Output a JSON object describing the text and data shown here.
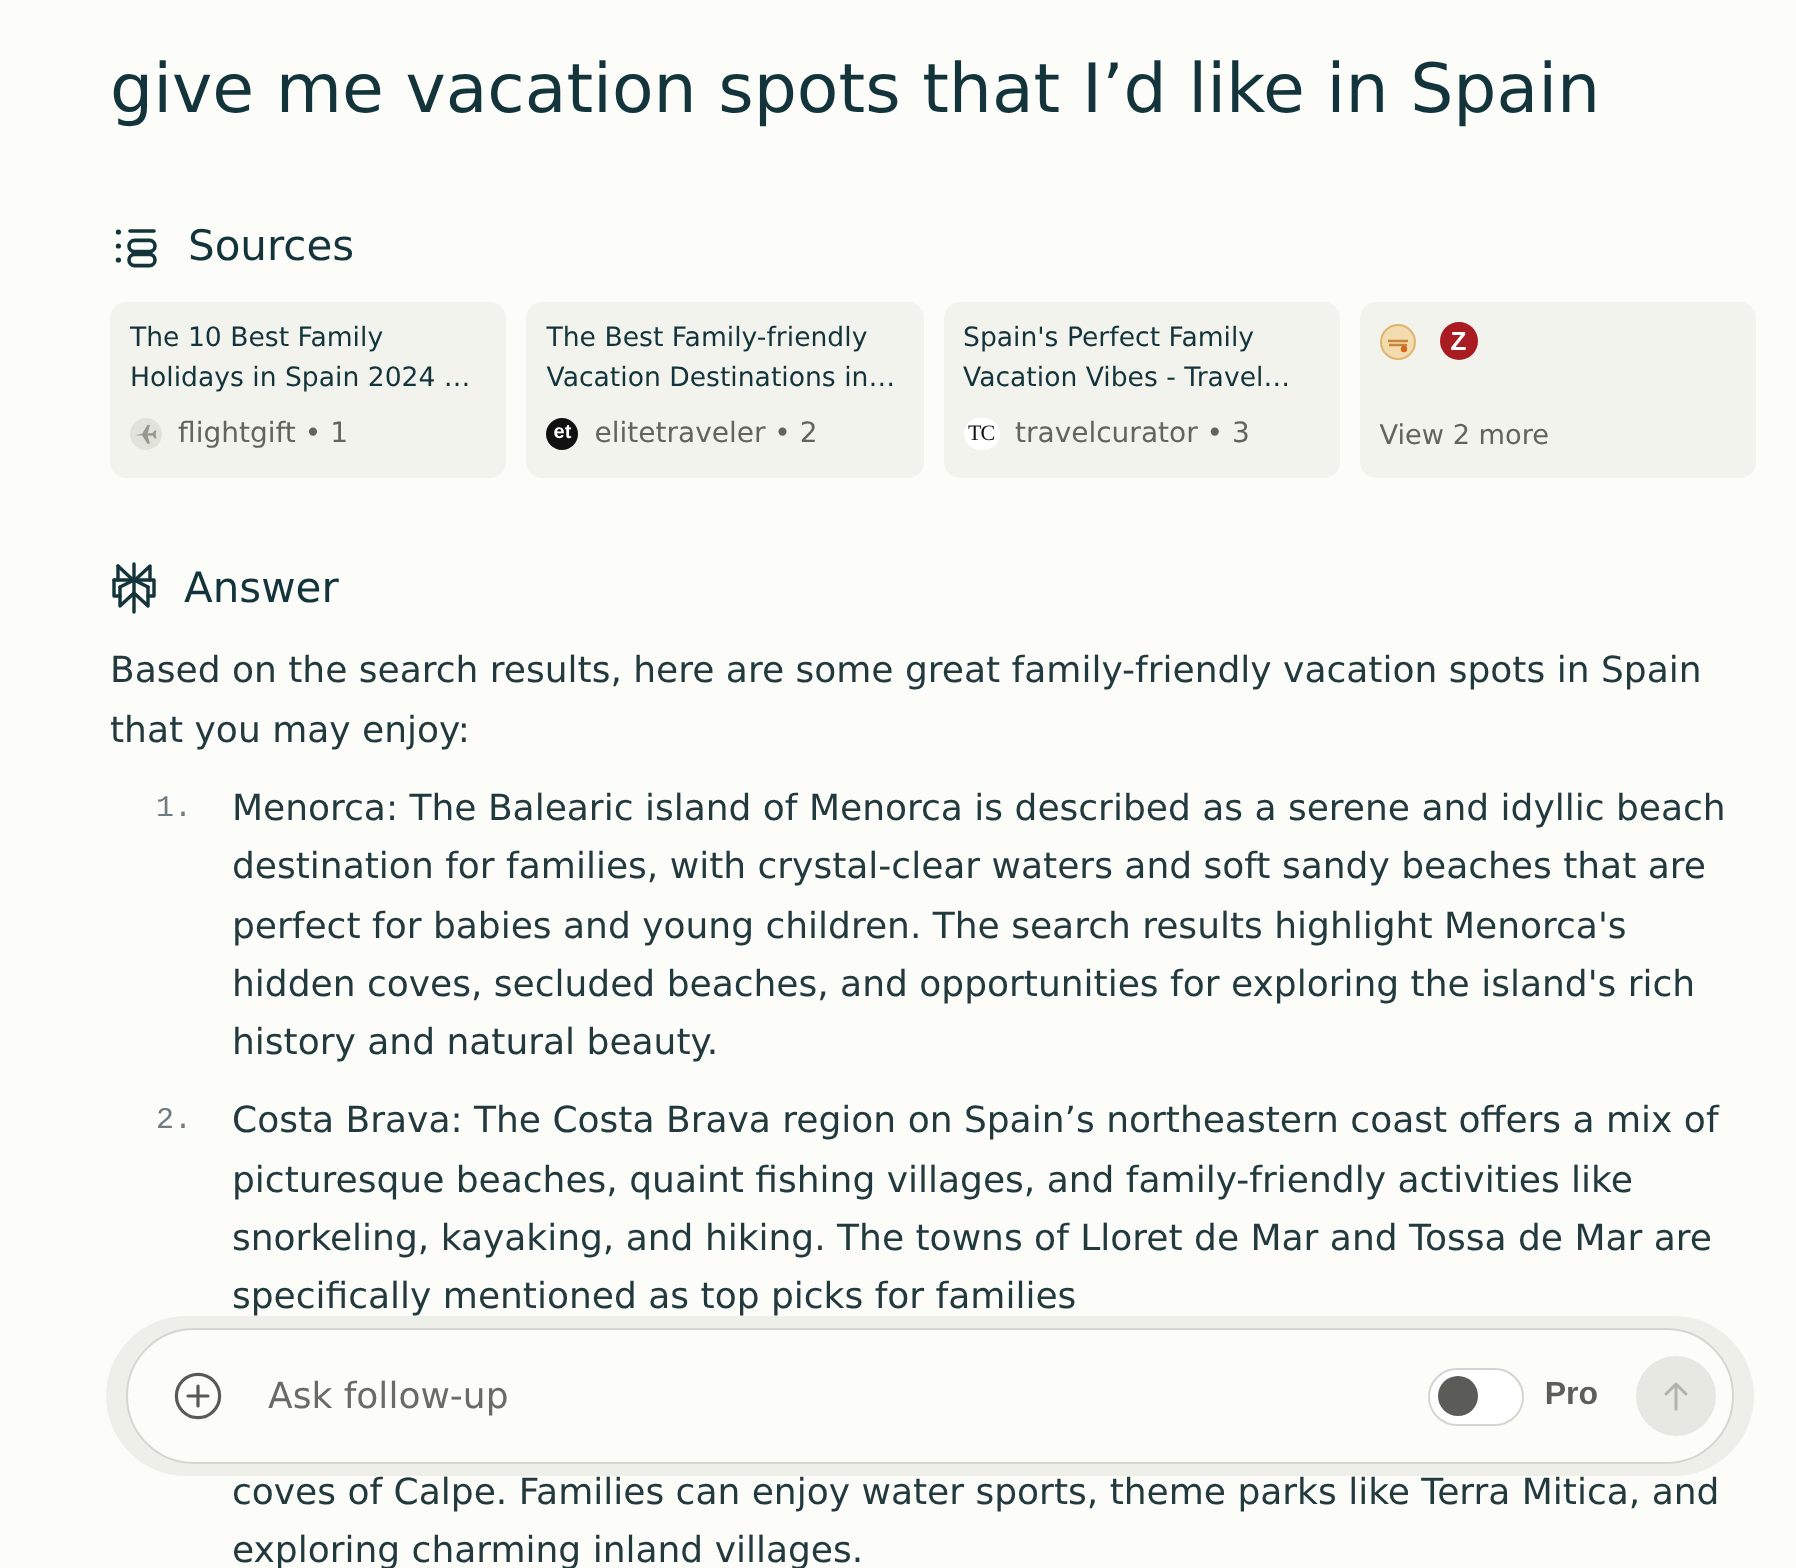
{
  "query": {
    "title": "give me vacation spots that I’d like in Spain"
  },
  "sources": {
    "heading": "Sources",
    "cards": [
      {
        "title": "The 10 Best Family Holidays in Spain 2024 …",
        "label": "flightgift • 1",
        "favicon": {
          "kind": "plane"
        }
      },
      {
        "title": "The Best Family-friendly Vacation Destinations in…",
        "label": "elitetraveler • 2",
        "favicon": {
          "kind": "inverse",
          "text": "et"
        }
      },
      {
        "title": "Spain's Perfect Family Vacation Vibes - Travel…",
        "label": "travelcurator • 3",
        "favicon": {
          "kind": "serif",
          "text": "TC"
        }
      }
    ],
    "more": {
      "favicons": [
        {
          "kind": "emblem"
        },
        {
          "kind": "letter",
          "text": "Z"
        }
      ],
      "label": "View 2 more"
    }
  },
  "answer": {
    "heading": "Answer",
    "intro": "Based on the search results, here are some great family-friendly vacation spots in Spain that you may enjoy:",
    "items": [
      {
        "number": "1.",
        "text": "Menorca: The Balearic island of Menorca is described as a serene and idyllic beach destination for families, with crystal-clear waters and soft sandy beaches that are perfect for babies and young children. The search results highlight Menorca's hidden coves, secluded beaches, and opportunities for exploring the island's rich history and natural beauty."
      },
      {
        "number": "2.",
        "text": "Costa Brava: The Costa Brava region on Spain’s northeastern coast offers a mix of picturesque beaches, quaint fishing villages, and family-friendly activities like snorkeling, kayaking, and hiking. The towns of Lloret de Mar and Tossa de Mar are specifically mentioned as top picks for families"
      }
    ],
    "continuation": "coves of Calpe. Families can enjoy water sports, theme parks like Terra Mitica, and exploring charming inland villages."
  },
  "composer": {
    "placeholder": "Ask follow-up",
    "pro_toggle": {
      "label": "Pro",
      "on": false
    },
    "submit": {
      "disabled": true
    }
  }
}
